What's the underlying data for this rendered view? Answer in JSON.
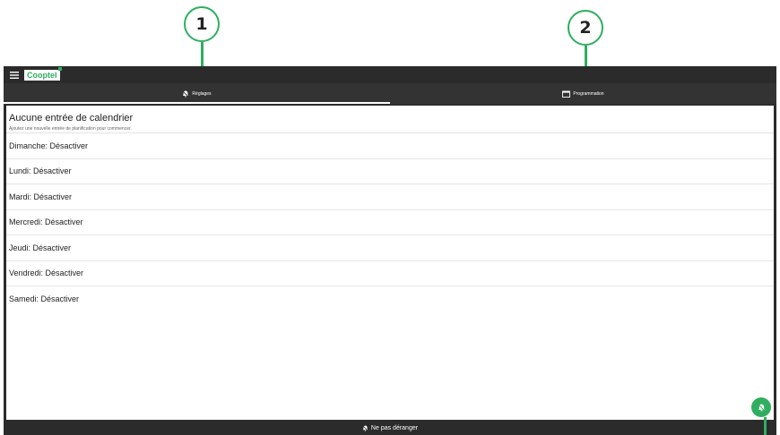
{
  "callouts": [
    {
      "label": "1"
    },
    {
      "label": "2"
    }
  ],
  "appbar": {
    "menu_icon": "hamburger-menu-icon",
    "logo_text": "Cooptel"
  },
  "tabs": [
    {
      "label": "Réglages",
      "icon": "bell-off-icon",
      "active": true
    },
    {
      "label": "Programmation",
      "icon": "calendar-icon",
      "active": false
    }
  ],
  "schedule": {
    "empty_title": "Aucune entrée de calendrier",
    "empty_subtitle": "Ajoutez une nouvelle entrée de planification pour commencer.",
    "days": [
      "Dimanche: Désactiver",
      "Lundi: Désactiver",
      "Mardi: Désactiver",
      "Mercredi: Désactiver",
      "Jeudi: Désactiver",
      "Vendredi: Désactiver",
      "Samedi: Désactiver"
    ]
  },
  "fab": {
    "icon": "bell-off-icon"
  },
  "bottom_bar": {
    "label": "Ne pas déranger",
    "icon": "bell-off-icon"
  },
  "colors": {
    "accent": "#2fae5f",
    "bar": "#2b2b2b",
    "tabs": "#333333"
  }
}
